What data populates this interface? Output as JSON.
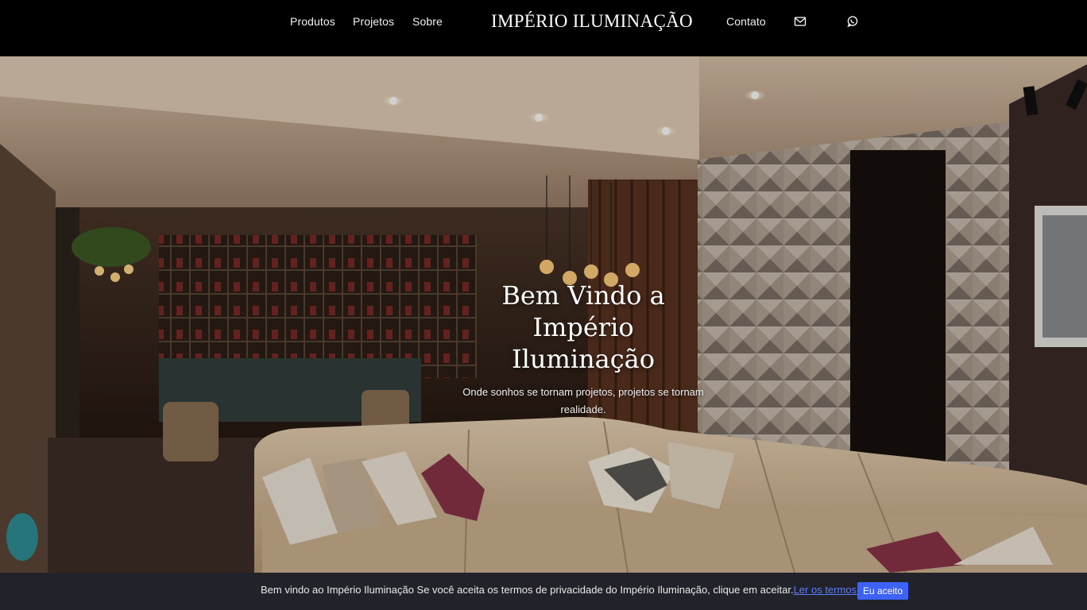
{
  "header": {
    "nav_left": [
      "Produtos",
      "Projetos",
      "Sobre"
    ],
    "brand": "IMPÉRIO ILUMINAÇÃO",
    "nav_right": "Contato",
    "icons": [
      "mail-icon",
      "whatsapp-icon"
    ]
  },
  "hero": {
    "title_lines": [
      "Bem Vindo a",
      "Império",
      "Iluminação"
    ],
    "subtitle": "Onde sonhos se tornam projetos, projetos se tornam realidade."
  },
  "cookie": {
    "text": "Bem vindo ao Império Iluminação Se você aceita os termos de privacidade do Império Iluminação, clique em aceitar.",
    "link": "Ler os termos.",
    "accept": "Eu aceito",
    "link_color": "#5d7cff",
    "button_color": "#3d62f5"
  }
}
